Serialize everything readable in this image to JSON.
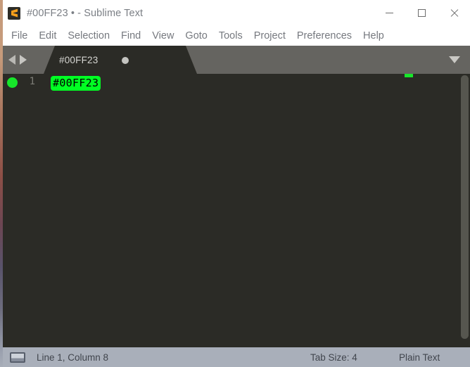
{
  "window": {
    "title": "#00FF23 • - Sublime Text",
    "app_icon": "sublime-text-logo",
    "controls": {
      "minimize": "minimize-icon",
      "maximize": "maximize-icon",
      "close": "close-icon"
    }
  },
  "menubar": {
    "items": [
      {
        "label": "File"
      },
      {
        "label": "Edit"
      },
      {
        "label": "Selection"
      },
      {
        "label": "Find"
      },
      {
        "label": "View"
      },
      {
        "label": "Goto"
      },
      {
        "label": "Tools"
      },
      {
        "label": "Project"
      },
      {
        "label": "Preferences"
      },
      {
        "label": "Help"
      }
    ]
  },
  "tabbar": {
    "nav_prev_icon": "arrow-left-icon",
    "nav_next_icon": "arrow-right-icon",
    "menu_icon": "chevron-down-icon",
    "tabs": [
      {
        "label": "#00FF23",
        "dirty": true,
        "dirty_icon": "unsaved-dot-icon",
        "active": true
      }
    ]
  },
  "editor": {
    "marker_icon": "bookmark-dot-icon",
    "marker_color": "#17E62A",
    "background": "#2B2B26",
    "lines": [
      {
        "number": "1",
        "text": "#00FF23",
        "highlight_color": "#00FF23",
        "text_color": "#000000"
      }
    ],
    "minimap": {
      "mark_color": "#17E62A"
    },
    "scrollbar": {
      "thumb_color": "#56564F"
    }
  },
  "statusbar": {
    "icon": "display-icon",
    "cursor_position": "Line 1, Column 8",
    "tab_size": "Tab Size: 4",
    "syntax": "Plain Text"
  },
  "colors": {
    "title_bar_bg": "#FFFFFF",
    "menu_text": "#76797F",
    "tabbar_bg": "#656460",
    "editor_bg": "#2B2B26",
    "statusbar_bg": "#A9AFBA",
    "accent_green": "#00FF23",
    "logo_orange": "#FF9800"
  }
}
